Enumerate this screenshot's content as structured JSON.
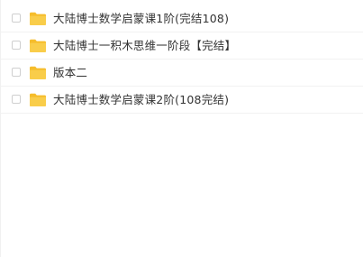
{
  "file_list": {
    "items": [
      {
        "name": "大陆博士数学启蒙课1阶(完结108)",
        "icon": "folder-icon"
      },
      {
        "name": "大陆博士一积木思维一阶段【完结】",
        "icon": "folder-icon"
      },
      {
        "name": "版本二",
        "icon": "folder-icon"
      },
      {
        "name": "大陆博士数学启蒙课2阶(108完结)",
        "icon": "folder-icon"
      }
    ]
  },
  "colors": {
    "folder": "#f9cd4a",
    "folder_tab": "#f6bd2b",
    "text": "#333333",
    "divider": "#f2f2f2"
  }
}
